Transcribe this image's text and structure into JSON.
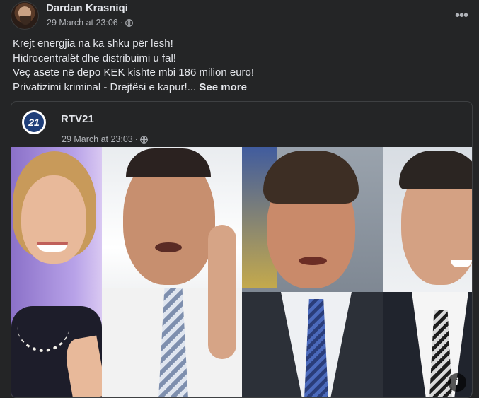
{
  "post": {
    "author": "Dardan Krasniqi",
    "timestamp": "29 March at 23:06",
    "separator": "·",
    "more_icon": "more-horizontal-icon",
    "text_lines": [
      "Krejt energjia na ka shku për lesh!",
      "Hidrocentralët dhe distribuimi u fal!",
      "Veç asete në depo KEK kishte mbi 186 milion euro!",
      "Privatizimi kriminal - Drejtësi e kapur!..."
    ],
    "see_more": "See more"
  },
  "shared": {
    "page_name": "RTV21",
    "logo_text": "21",
    "timestamp": "29 March at 23:03",
    "separator": "·",
    "info_icon_label": "i"
  },
  "colors": {
    "background": "#242526",
    "text_primary": "#e4e6eb",
    "text_secondary": "#b0b3b8",
    "border": "#3e4042"
  }
}
